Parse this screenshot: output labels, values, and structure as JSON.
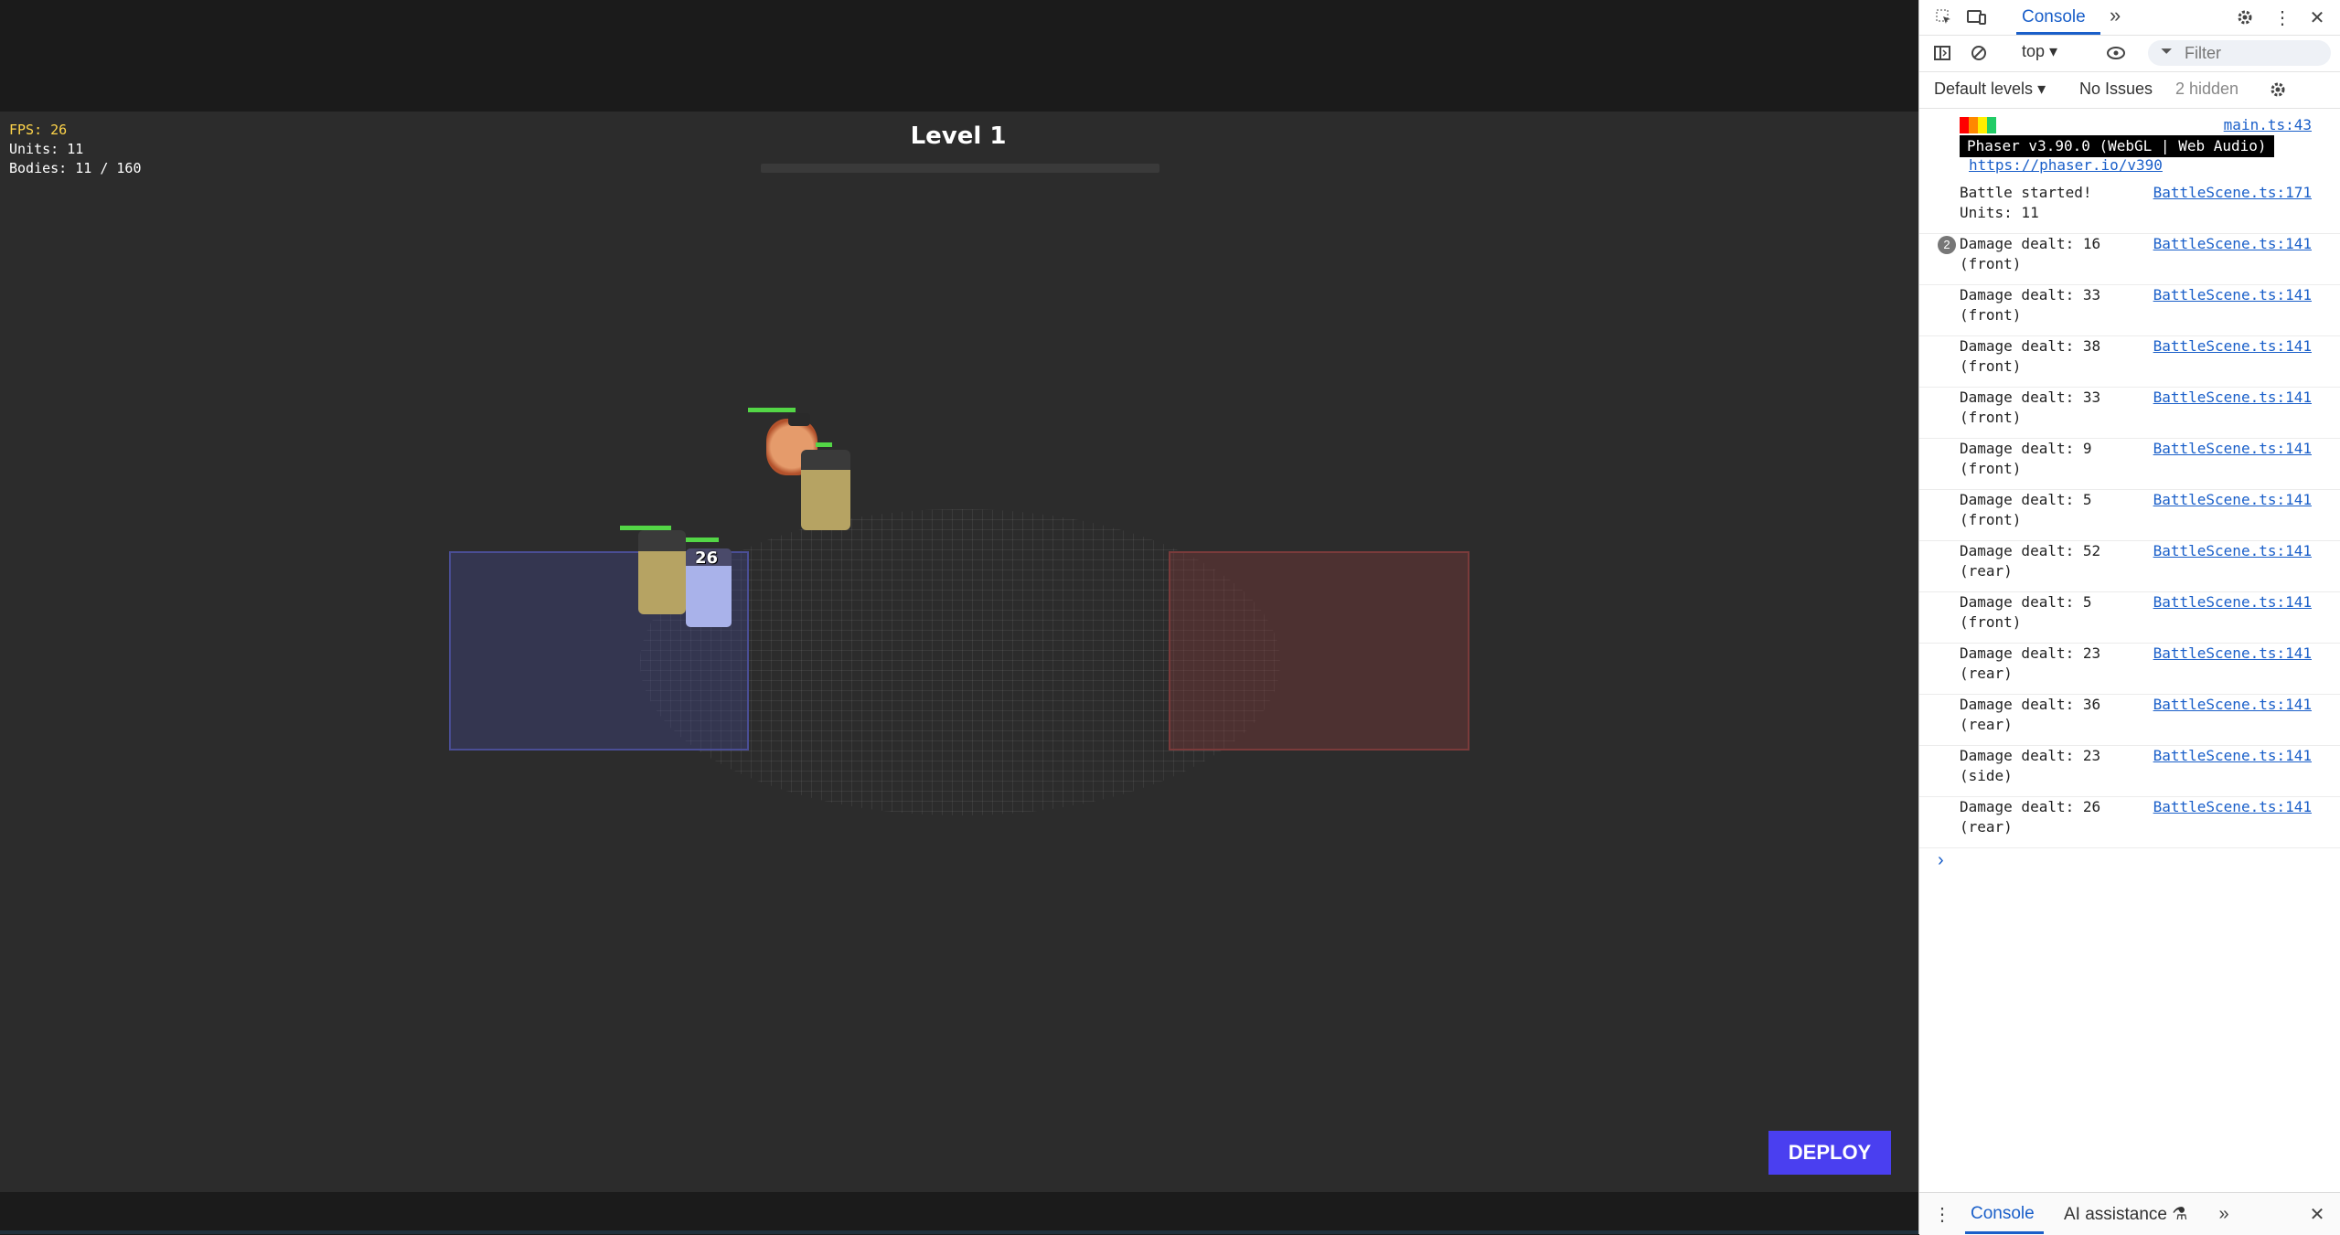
{
  "game": {
    "hud": {
      "fps": "FPS: 26",
      "units": "Units: 11",
      "bodies": "Bodies: 11 / 160"
    },
    "level_title": "Level 1",
    "damage_popup": "26",
    "deploy_label": "DEPLOY",
    "colors": {
      "deploy": "#4a3ff0",
      "hp": "#53d646",
      "fps": "#ffd54a"
    }
  },
  "devtools": {
    "tabs": {
      "console": "Console"
    },
    "toolbar": {
      "context": "top",
      "filter_placeholder": "Filter"
    },
    "levels": {
      "default_levels": "Default levels",
      "issues": "No Issues",
      "hidden": "2 hidden"
    },
    "logs": [
      {
        "text": "Battle started!\nUnits: 11",
        "source": "BattleScene.ts:171"
      },
      {
        "count": "2",
        "text": "Damage dealt: 16\n(front)",
        "source": "BattleScene.ts:141"
      },
      {
        "text": "Damage dealt: 33\n(front)",
        "source": "BattleScene.ts:141"
      },
      {
        "text": "Damage dealt: 38\n(front)",
        "source": "BattleScene.ts:141"
      },
      {
        "text": "Damage dealt: 33\n(front)",
        "source": "BattleScene.ts:141"
      },
      {
        "text": "Damage dealt: 9\n(front)",
        "source": "BattleScene.ts:141"
      },
      {
        "text": "Damage dealt: 5\n(front)",
        "source": "BattleScene.ts:141"
      },
      {
        "text": "Damage dealt: 52\n(rear)",
        "source": "BattleScene.ts:141"
      },
      {
        "text": "Damage dealt: 5\n(front)",
        "source": "BattleScene.ts:141"
      },
      {
        "text": "Damage dealt: 23\n(rear)",
        "source": "BattleScene.ts:141"
      },
      {
        "text": "Damage dealt: 36\n(rear)",
        "source": "BattleScene.ts:141"
      },
      {
        "text": "Damage dealt: 23\n(side)",
        "source": "BattleScene.ts:141"
      },
      {
        "text": "Damage dealt: 26\n(rear)",
        "source": "BattleScene.ts:141"
      }
    ],
    "phaser": {
      "source": "main.ts:43",
      "banner": "Phaser v3.90.0 (WebGL | Web Audio)",
      "link": "https://phaser.io/v390"
    },
    "bottom": {
      "console": "Console",
      "ai": "AI assistance"
    }
  }
}
